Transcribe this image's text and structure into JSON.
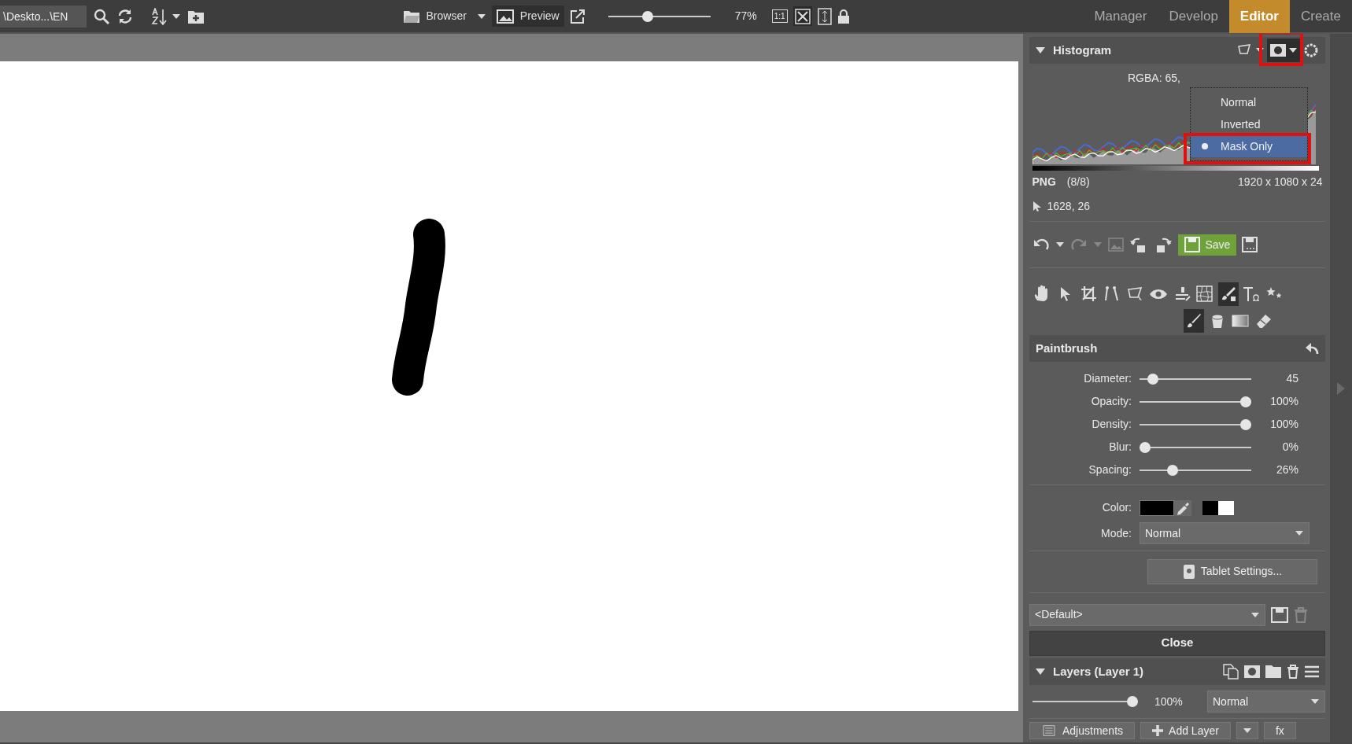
{
  "toolbar": {
    "path": "\\Deskto...\\EN",
    "view_buttons": [
      {
        "label": "Browser",
        "selected": false
      },
      {
        "label": "Preview",
        "selected": true
      }
    ],
    "zoom": {
      "level": 0.37,
      "reading": "77%"
    },
    "actual_size": "1:1",
    "fit_selected": true
  },
  "modules": [
    {
      "label": "Manager",
      "selected": false
    },
    {
      "label": "Develop",
      "selected": false
    },
    {
      "label": "Editor",
      "selected": true
    },
    {
      "label": "Create",
      "selected": false
    }
  ],
  "histogram": {
    "title": "Histogram",
    "rgba": "RGBA:  65,",
    "mask_menu": [
      {
        "label": "Normal",
        "selected": false
      },
      {
        "label": "Inverted",
        "selected": false
      },
      {
        "label": "Mask Only",
        "selected": true
      }
    ],
    "format": "PNG",
    "format_depth": "(8/8)",
    "dimensions": "1920 x 1080 x 24",
    "cursor": "1628, 26"
  },
  "save_button": "Save",
  "tools": [
    {
      "kind": "hand",
      "selected": false
    },
    {
      "kind": "pointer",
      "selected": false
    },
    {
      "kind": "crop",
      "selected": false
    },
    {
      "kind": "straighten",
      "selected": false
    },
    {
      "kind": "perspective",
      "selected": false
    },
    {
      "kind": "eye",
      "selected": false
    },
    {
      "kind": "clone",
      "selected": false
    },
    {
      "kind": "warp",
      "selected": false
    },
    {
      "kind": "maskbrush",
      "selected": true
    },
    {
      "kind": "text",
      "selected": false
    },
    {
      "kind": "effects",
      "selected": false
    }
  ],
  "subtools": [
    {
      "kind": "brush",
      "selected": true
    },
    {
      "kind": "bucket",
      "selected": false
    },
    {
      "kind": "gradient",
      "selected": false
    },
    {
      "kind": "eraser",
      "selected": false
    }
  ],
  "tool_title": "Paintbrush",
  "sliders": [
    {
      "label": "Diameter:",
      "level": 0.08,
      "reading": "45"
    },
    {
      "label": "Opacity:",
      "level": 1,
      "reading": "100%"
    },
    {
      "label": "Density:",
      "level": 1,
      "reading": "100%"
    },
    {
      "label": "Blur:",
      "level": 0,
      "reading": "0%"
    },
    {
      "label": "Spacing:",
      "level": 0.27,
      "reading": "26%"
    }
  ],
  "color": {
    "label": "Color:",
    "color": "#000000"
  },
  "mode": {
    "label": "Mode:",
    "value": "Normal"
  },
  "tablet_button": "Tablet Settings...",
  "preset": "<Default>",
  "close_button": "Close",
  "layers": {
    "title": "Layers (Layer 1)",
    "opacity": {
      "level": 1,
      "reading": "100%"
    },
    "blend": "Normal"
  },
  "bottom_buttons": [
    "Adjustments",
    "Add Layer",
    "fx"
  ]
}
